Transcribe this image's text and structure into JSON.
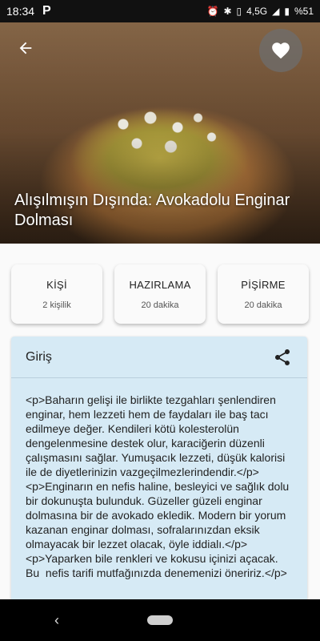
{
  "statusbar": {
    "time": "18:34",
    "app_icon": "P",
    "network": "4,5G",
    "battery": "%51"
  },
  "hero": {
    "title": "Alışılmışın Dışında: Avokadolu Enginar Dolması"
  },
  "stats": [
    {
      "title": "KİŞİ",
      "value": "2 kişilik"
    },
    {
      "title": "HAZIRLAMA",
      "value": "20 dakika"
    },
    {
      "title": "PİŞİRME",
      "value": "20 dakika"
    }
  ],
  "intro": {
    "title": "Giriş",
    "body": "<p>Baharın gelişi ile birlikte tezgahları şenlendiren enginar, hem lezzeti hem de faydaları ile baş tacı edilmeye değer. Kendileri kötü kolesterolün dengelenmesine destek olur, karaciğerin düzenli çalışmasını sağlar. Yumuşacık lezzeti, düşük kalorisi ile de diyetlerinizin vazgeçilmezlerindendir.</p>\n<p>Enginarın en nefis haline, besleyici ve sağlık dolu bir dokunuşta bulunduk. Güzeller güzeli enginar dolmasına bir de avokado ekledik. Modern bir yorum kazanan enginar dolması, sofralarınızdan eksik olmayacak bir lezzet olacak, öyle iddialı.</p>\n<p>Yaparken bile renkleri ve kokusu içinizi açacak. Bu  nefis tarifi mutfağınızda denemenizi öneririz.</p>"
  },
  "icons": {
    "back": "arrow-back-icon",
    "favorite": "heart-icon",
    "share": "share-icon"
  }
}
